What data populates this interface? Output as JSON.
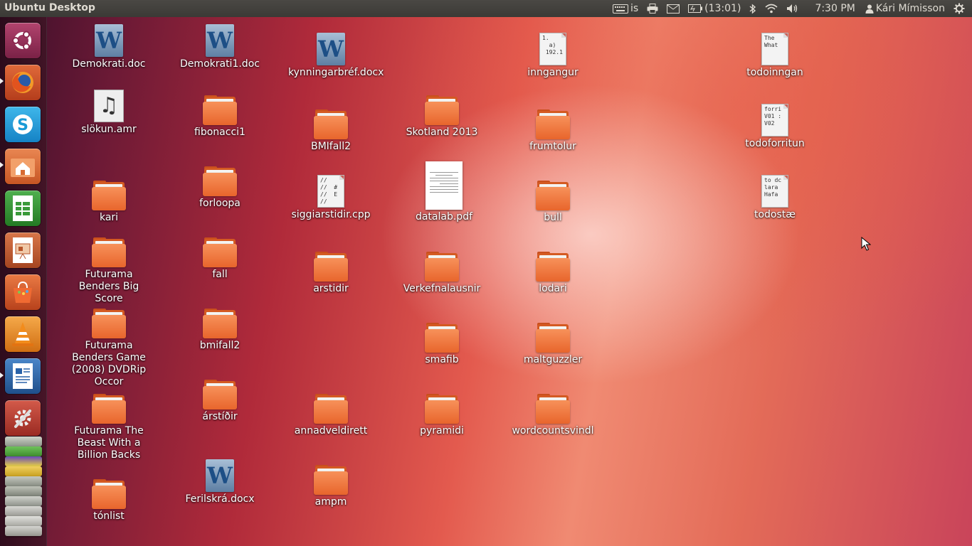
{
  "topbar": {
    "title": "Ubuntu Desktop",
    "keyboard_layout": "is",
    "battery_time": "(13:01)",
    "clock": "7:30 PM",
    "user_name": "Kári Mímisson"
  },
  "launcher": [
    {
      "name": "dash-home",
      "icon": "ubuntu-logo-icon",
      "color": "#8b2a4f"
    },
    {
      "name": "firefox",
      "icon": "firefox-icon",
      "color": "#c64a1a"
    },
    {
      "name": "skype",
      "icon": "skype-icon",
      "color": "#1a9ad6"
    },
    {
      "name": "files",
      "icon": "home-folder-icon",
      "color": "#d76a32"
    },
    {
      "name": "libreoffice-calc",
      "icon": "spreadsheet-icon",
      "color": "#2f8f2f"
    },
    {
      "name": "libreoffice-impress",
      "icon": "presentation-icon",
      "color": "#b7542a"
    },
    {
      "name": "software-center",
      "icon": "shopping-bag-icon",
      "color": "#d9532b"
    },
    {
      "name": "vlc",
      "icon": "traffic-cone-icon",
      "color": "#e88a1a"
    },
    {
      "name": "libreoffice-writer",
      "icon": "document-icon",
      "color": "#2a63a8"
    },
    {
      "name": "system-settings",
      "icon": "wrench-gear-icon",
      "color": "#c0392b"
    }
  ],
  "desktop": {
    "items": [
      {
        "label": "Demokrati.doc",
        "type": "word"
      },
      {
        "label": "Demokrati1.doc",
        "type": "word"
      },
      {
        "label": "kynningarbréf.docx",
        "type": "word"
      },
      {
        "label": "inngangur",
        "type": "text",
        "preview": "1.\n  a)\n 192.1"
      },
      {
        "label": "todoinngan",
        "type": "text",
        "preview": "The \nWhat"
      },
      {
        "label": "slökun.amr",
        "type": "audio"
      },
      {
        "label": "fibonacci1",
        "type": "folder"
      },
      {
        "label": "BMIfall2",
        "type": "folder"
      },
      {
        "label": "Skotland 2013",
        "type": "folder"
      },
      {
        "label": "frumtolur",
        "type": "folder"
      },
      {
        "label": "todoforritun",
        "type": "text",
        "preview": "forri\nV01 :\nV02"
      },
      {
        "label": "kari",
        "type": "folder"
      },
      {
        "label": "forloopa",
        "type": "folder"
      },
      {
        "label": "siggiarstidir.cpp",
        "type": "text",
        "preview": "//\n//  #\n//  E\n//"
      },
      {
        "label": "datalab.pdf",
        "type": "pdf"
      },
      {
        "label": "bull",
        "type": "folder"
      },
      {
        "label": "todostæ",
        "type": "text",
        "preview": "to dc\nlara\nHafa"
      },
      {
        "label": "Futurama Benders Big Score",
        "type": "folder"
      },
      {
        "label": "fall",
        "type": "folder"
      },
      {
        "label": "arstidir",
        "type": "folder"
      },
      {
        "label": "Verkefnalausnir",
        "type": "folder"
      },
      {
        "label": "lodari",
        "type": "folder"
      },
      {
        "label": "Futurama Benders Game (2008) DVDRip Occor",
        "type": "folder"
      },
      {
        "label": "bmifall2",
        "type": "folder"
      },
      {
        "label": "smafib",
        "type": "folder"
      },
      {
        "label": "maltguzzler",
        "type": "folder"
      },
      {
        "label": "Futurama  The Beast With a Billion Backs",
        "type": "folder"
      },
      {
        "label": "árstíðir",
        "type": "folder"
      },
      {
        "label": "annadveldirett",
        "type": "folder"
      },
      {
        "label": "pyramidi",
        "type": "folder"
      },
      {
        "label": "wordcountsvindl",
        "type": "folder"
      },
      {
        "label": "tónlist",
        "type": "folder"
      },
      {
        "label": "Ferilskrá.docx",
        "type": "word"
      },
      {
        "label": "ampm",
        "type": "folder"
      }
    ]
  }
}
